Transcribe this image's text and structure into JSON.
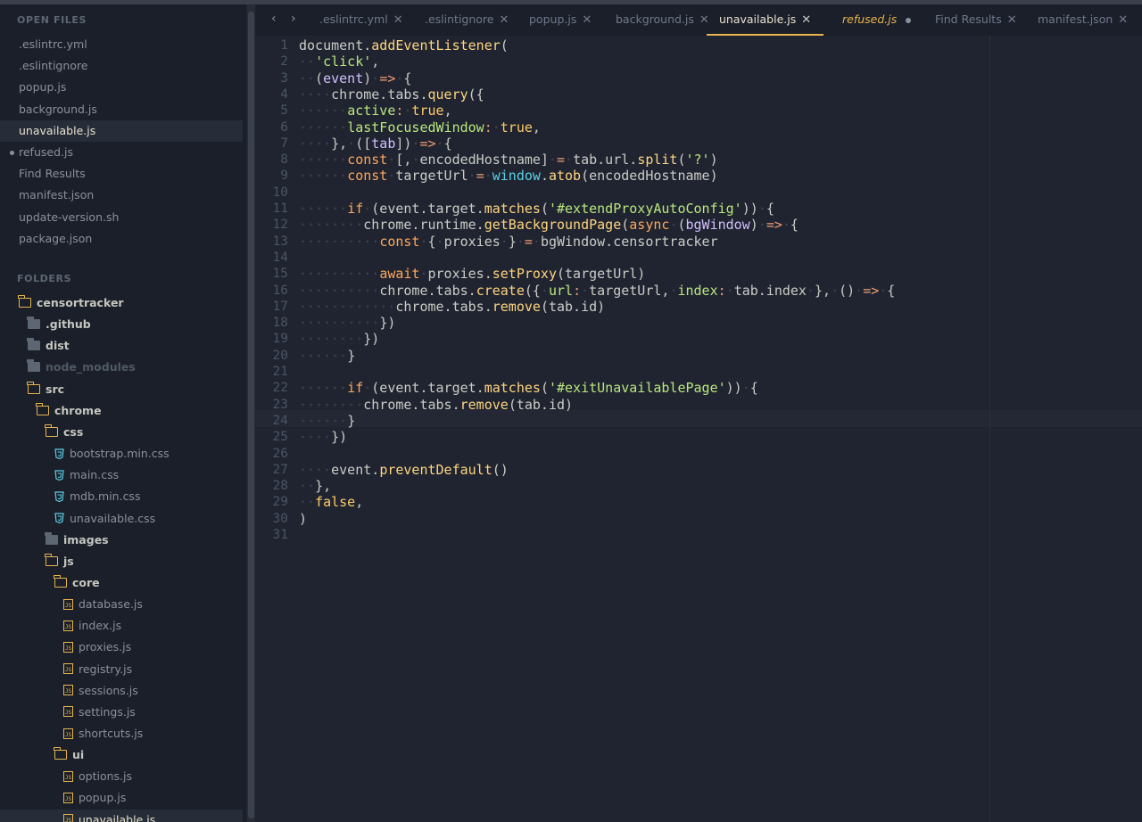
{
  "sidebar": {
    "open_files_title": "OPEN FILES",
    "open_files": [
      {
        "label": ".eslintrc.yml"
      },
      {
        "label": ".eslintignore"
      },
      {
        "label": "popup.js"
      },
      {
        "label": "background.js"
      },
      {
        "label": "unavailable.js",
        "active": true
      },
      {
        "label": "refused.js",
        "modified": true
      },
      {
        "label": "Find Results"
      },
      {
        "label": "manifest.json"
      },
      {
        "label": "update-version.sh"
      },
      {
        "label": "package.json"
      }
    ],
    "folders_title": "FOLDERS",
    "tree": [
      {
        "label": "censortracker",
        "kind": "folder-open",
        "depth": 0
      },
      {
        "label": ".github",
        "kind": "folder-closed",
        "depth": 1
      },
      {
        "label": "dist",
        "kind": "folder-closed",
        "depth": 1
      },
      {
        "label": "node_modules",
        "kind": "folder-closed",
        "depth": 1,
        "dim": true
      },
      {
        "label": "src",
        "kind": "folder-open",
        "depth": 1
      },
      {
        "label": "chrome",
        "kind": "folder-open",
        "depth": 2
      },
      {
        "label": "css",
        "kind": "folder-open",
        "depth": 3
      },
      {
        "label": "bootstrap.min.css",
        "kind": "css",
        "depth": 4
      },
      {
        "label": "main.css",
        "kind": "css",
        "depth": 4
      },
      {
        "label": "mdb.min.css",
        "kind": "css",
        "depth": 4
      },
      {
        "label": "unavailable.css",
        "kind": "css",
        "depth": 4
      },
      {
        "label": "images",
        "kind": "folder-closed",
        "depth": 3
      },
      {
        "label": "js",
        "kind": "folder-open",
        "depth": 3
      },
      {
        "label": "core",
        "kind": "folder-open",
        "depth": 4
      },
      {
        "label": "database.js",
        "kind": "js",
        "depth": 5
      },
      {
        "label": "index.js",
        "kind": "js",
        "depth": 5
      },
      {
        "label": "proxies.js",
        "kind": "js",
        "depth": 5
      },
      {
        "label": "registry.js",
        "kind": "js",
        "depth": 5
      },
      {
        "label": "sessions.js",
        "kind": "js",
        "depth": 5
      },
      {
        "label": "settings.js",
        "kind": "js",
        "depth": 5
      },
      {
        "label": "shortcuts.js",
        "kind": "js",
        "depth": 5
      },
      {
        "label": "ui",
        "kind": "folder-open",
        "depth": 4
      },
      {
        "label": "options.js",
        "kind": "js",
        "depth": 5
      },
      {
        "label": "popup.js",
        "kind": "js",
        "depth": 5
      },
      {
        "label": "unavailable.js",
        "kind": "js",
        "depth": 5,
        "selected": true
      }
    ]
  },
  "tabs": [
    {
      "label": ".eslintrc.yml",
      "close": "✕"
    },
    {
      "label": ".eslintignore",
      "close": "✕"
    },
    {
      "label": "popup.js",
      "close": "✕"
    },
    {
      "label": "background.js",
      "close": "✕"
    },
    {
      "label": "unavailable.js",
      "close": "✕",
      "active": true
    },
    {
      "label": "refused.js",
      "modified": true,
      "italic": true
    },
    {
      "label": "Find Results",
      "close": "✕"
    },
    {
      "label": "manifest.json",
      "close": "✕"
    }
  ],
  "nav": {
    "back": "‹",
    "forward": "›"
  },
  "editor": {
    "current_line": 24,
    "lines": [
      [
        [
          "plain",
          "document"
        ],
        [
          "plain",
          "."
        ],
        [
          "fn",
          "addEventListener"
        ],
        [
          "plain",
          "("
        ]
      ],
      [
        [
          "ws",
          "··"
        ],
        [
          "str",
          "'click'"
        ],
        [
          "plain",
          ","
        ]
      ],
      [
        [
          "ws",
          "··"
        ],
        [
          "plain",
          "("
        ],
        [
          "param",
          "event"
        ],
        [
          "plain",
          ")"
        ],
        [
          "ws",
          "·"
        ],
        [
          "op",
          "=>"
        ],
        [
          "ws",
          "·"
        ],
        [
          "plain",
          "{"
        ]
      ],
      [
        [
          "ws",
          "····"
        ],
        [
          "plain",
          "chrome.tabs."
        ],
        [
          "fn",
          "query"
        ],
        [
          "plain",
          "({"
        ]
      ],
      [
        [
          "ws",
          "······"
        ],
        [
          "prop",
          "active"
        ],
        [
          "op",
          ":"
        ],
        [
          "ws",
          "·"
        ],
        [
          "boolc",
          "true"
        ],
        [
          "plain",
          ","
        ]
      ],
      [
        [
          "ws",
          "······"
        ],
        [
          "prop",
          "lastFocusedWindow"
        ],
        [
          "op",
          ":"
        ],
        [
          "ws",
          "·"
        ],
        [
          "boolc",
          "true"
        ],
        [
          "plain",
          ","
        ]
      ],
      [
        [
          "ws",
          "····"
        ],
        [
          "plain",
          "},"
        ],
        [
          "ws",
          "·"
        ],
        [
          "plain",
          "(["
        ],
        [
          "param",
          "tab"
        ],
        [
          "plain",
          "])"
        ],
        [
          "ws",
          "·"
        ],
        [
          "op",
          "=>"
        ],
        [
          "ws",
          "·"
        ],
        [
          "plain",
          "{"
        ]
      ],
      [
        [
          "ws",
          "······"
        ],
        [
          "kw",
          "const"
        ],
        [
          "ws",
          "·"
        ],
        [
          "plain",
          "[,"
        ],
        [
          "ws",
          "·"
        ],
        [
          "plain",
          "encodedHostname]"
        ],
        [
          "ws",
          "·"
        ],
        [
          "op",
          "="
        ],
        [
          "ws",
          "·"
        ],
        [
          "plain",
          "tab.url."
        ],
        [
          "fn",
          "split"
        ],
        [
          "plain",
          "("
        ],
        [
          "str",
          "'?'"
        ],
        [
          "plain",
          ")"
        ]
      ],
      [
        [
          "ws",
          "······"
        ],
        [
          "kw",
          "const"
        ],
        [
          "ws",
          "·"
        ],
        [
          "plain",
          "targetUrl"
        ],
        [
          "ws",
          "·"
        ],
        [
          "op",
          "="
        ],
        [
          "ws",
          "·"
        ],
        [
          "glob",
          "window"
        ],
        [
          "plain",
          "."
        ],
        [
          "fn",
          "atob"
        ],
        [
          "plain",
          "(encodedHostname)"
        ]
      ],
      [],
      [
        [
          "ws",
          "······"
        ],
        [
          "kw",
          "if"
        ],
        [
          "ws",
          "·"
        ],
        [
          "plain",
          "(event.target."
        ],
        [
          "fn",
          "matches"
        ],
        [
          "plain",
          "("
        ],
        [
          "str",
          "'#extendProxyAutoConfig'"
        ],
        [
          "plain",
          "))"
        ],
        [
          "ws",
          "·"
        ],
        [
          "plain",
          "{"
        ]
      ],
      [
        [
          "ws",
          "········"
        ],
        [
          "plain",
          "chrome.runtime."
        ],
        [
          "fn",
          "getBackgroundPage"
        ],
        [
          "plain",
          "("
        ],
        [
          "kw",
          "async"
        ],
        [
          "ws",
          "·"
        ],
        [
          "plain",
          "("
        ],
        [
          "param",
          "bgWindow"
        ],
        [
          "plain",
          ")"
        ],
        [
          "ws",
          "·"
        ],
        [
          "op",
          "=>"
        ],
        [
          "ws",
          "·"
        ],
        [
          "plain",
          "{"
        ]
      ],
      [
        [
          "ws",
          "··········"
        ],
        [
          "kw",
          "const"
        ],
        [
          "ws",
          "·"
        ],
        [
          "plain",
          "{"
        ],
        [
          "ws",
          "·"
        ],
        [
          "plain",
          "proxies"
        ],
        [
          "ws",
          "·"
        ],
        [
          "plain",
          "}"
        ],
        [
          "ws",
          "·"
        ],
        [
          "op",
          "="
        ],
        [
          "ws",
          "·"
        ],
        [
          "plain",
          "bgWindow.censortracker"
        ]
      ],
      [],
      [
        [
          "ws",
          "··········"
        ],
        [
          "kw",
          "await"
        ],
        [
          "ws",
          "·"
        ],
        [
          "plain",
          "proxies."
        ],
        [
          "fn",
          "setProxy"
        ],
        [
          "plain",
          "(targetUrl)"
        ]
      ],
      [
        [
          "ws",
          "··········"
        ],
        [
          "plain",
          "chrome.tabs."
        ],
        [
          "fn",
          "create"
        ],
        [
          "plain",
          "({"
        ],
        [
          "ws",
          "·"
        ],
        [
          "prop",
          "url"
        ],
        [
          "op",
          ":"
        ],
        [
          "ws",
          "·"
        ],
        [
          "plain",
          "targetUrl,"
        ],
        [
          "ws",
          "·"
        ],
        [
          "prop",
          "index"
        ],
        [
          "op",
          ":"
        ],
        [
          "ws",
          "·"
        ],
        [
          "plain",
          "tab.index"
        ],
        [
          "ws",
          "·"
        ],
        [
          "plain",
          "},"
        ],
        [
          "ws",
          "·"
        ],
        [
          "plain",
          "()"
        ],
        [
          "ws",
          "·"
        ],
        [
          "op",
          "=>"
        ],
        [
          "ws",
          "·"
        ],
        [
          "plain",
          "{"
        ]
      ],
      [
        [
          "ws",
          "············"
        ],
        [
          "plain",
          "chrome.tabs."
        ],
        [
          "fn",
          "remove"
        ],
        [
          "plain",
          "(tab.id)"
        ]
      ],
      [
        [
          "ws",
          "··········"
        ],
        [
          "plain",
          "})"
        ]
      ],
      [
        [
          "ws",
          "········"
        ],
        [
          "plain",
          "})"
        ]
      ],
      [
        [
          "ws",
          "······"
        ],
        [
          "plain",
          "}"
        ]
      ],
      [],
      [
        [
          "ws",
          "······"
        ],
        [
          "kw",
          "if"
        ],
        [
          "ws",
          "·"
        ],
        [
          "plain",
          "(event.target."
        ],
        [
          "fn",
          "matches"
        ],
        [
          "plain",
          "("
        ],
        [
          "str",
          "'#exitUnavailablePage'"
        ],
        [
          "plain",
          "))"
        ],
        [
          "ws",
          "·"
        ],
        [
          "plain",
          "{"
        ]
      ],
      [
        [
          "ws",
          "········"
        ],
        [
          "plain",
          "chrome.tabs."
        ],
        [
          "fn",
          "remove"
        ],
        [
          "plain",
          "(tab.id)"
        ]
      ],
      [
        [
          "ws",
          "······"
        ],
        [
          "plain",
          "}"
        ]
      ],
      [
        [
          "ws",
          "····"
        ],
        [
          "plain",
          "})"
        ]
      ],
      [],
      [
        [
          "ws",
          "····"
        ],
        [
          "plain",
          "event."
        ],
        [
          "fn",
          "preventDefault"
        ],
        [
          "plain",
          "()"
        ]
      ],
      [
        [
          "ws",
          "··"
        ],
        [
          "plain",
          "},"
        ]
      ],
      [
        [
          "ws",
          "··"
        ],
        [
          "boolc",
          "false"
        ],
        [
          "plain",
          ","
        ]
      ],
      [
        [
          "plain",
          ")"
        ]
      ],
      []
    ]
  }
}
